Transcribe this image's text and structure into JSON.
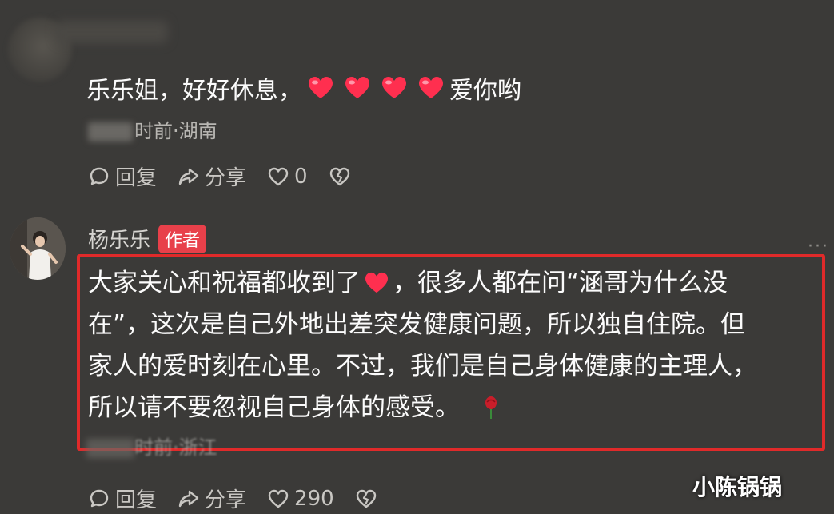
{
  "comment1": {
    "text_before": "乐乐姐，好好休息，",
    "text_after": "爱你哟",
    "hearts": 4,
    "meta": "时前·湖南",
    "actions": {
      "reply_label": "回复",
      "share_label": "分享",
      "like_count": "0"
    }
  },
  "comment2": {
    "author": "杨乐乐",
    "author_tag": "作者",
    "more": "···",
    "lines": [
      "大家关心和祝福都收到了",
      "，很多人都在问“涵哥为什么没",
      "在”，这次是自己外地出差突发健康问题，所以独自住院。但",
      "家人的爱时刻在心里。不过，我们是自己身体健康的主理人，",
      "所以请不要忽视自己身体的感受。"
    ],
    "meta": "时前·浙江",
    "actions": {
      "reply_label": "回复",
      "share_label": "分享",
      "like_count": "290"
    }
  },
  "watermark": "小陈锅锅",
  "colors": {
    "background": "#3b3a38",
    "highlight_border": "#e02a2a",
    "author_tag": "#e8404a",
    "heart": "#ff2f4f"
  },
  "icons": [
    "comment-icon",
    "share-icon",
    "like-icon",
    "dislike-icon",
    "heart-emoji",
    "rose-emoji"
  ]
}
